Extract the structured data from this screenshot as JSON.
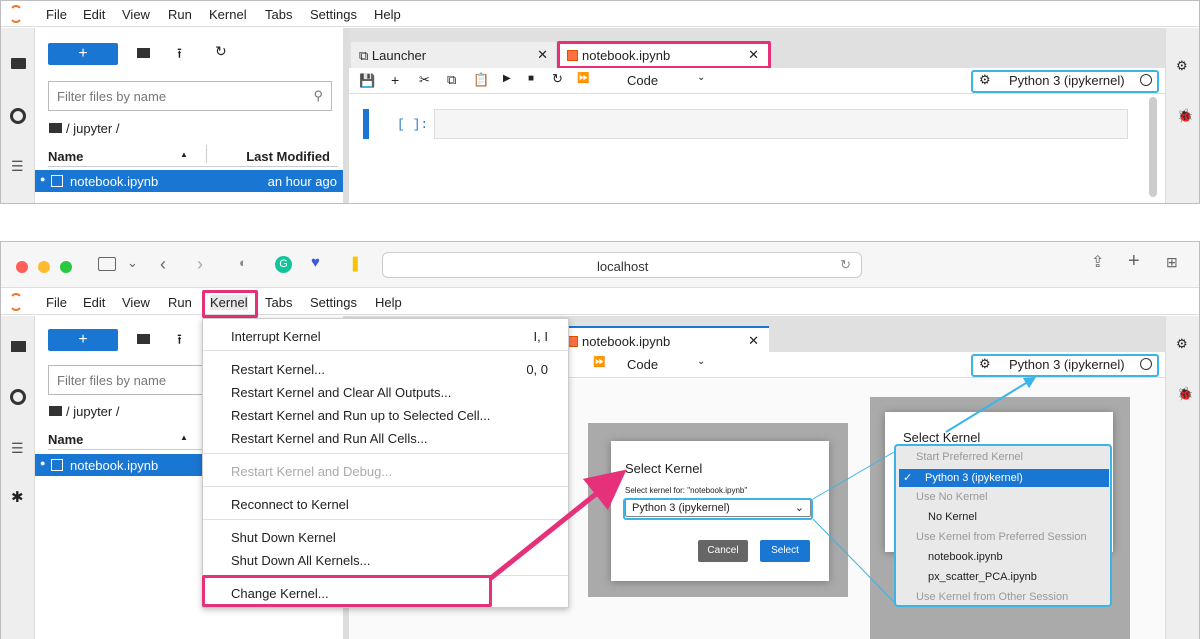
{
  "top": {
    "menu": [
      "File",
      "Edit",
      "View",
      "Run",
      "Kernel",
      "Tabs",
      "Settings",
      "Help"
    ],
    "filter_placeholder": "Filter files by name",
    "path": "/ jupyter /",
    "col_name": "Name",
    "col_modified": "Last Modified",
    "file_name": "notebook.ipynb",
    "file_modified": "an hour ago",
    "tab_launcher": "Launcher",
    "tab_notebook": "notebook.ipynb",
    "cell_type": "Code",
    "kernel_name": "Python 3 (ipykernel)",
    "prompt": "[ ]:"
  },
  "browser": {
    "url": "localhost"
  },
  "bottom": {
    "menu": [
      "File",
      "Edit",
      "View",
      "Run",
      "Kernel",
      "Tabs",
      "Settings",
      "Help"
    ],
    "filter_placeholder": "Filter files by name",
    "path": "/ jupyter /",
    "col_name": "Name",
    "file_name": "notebook.ipynb",
    "tab_notebook": "notebook.ipynb",
    "cell_type": "Code",
    "kernel_name": "Python 3 (ipykernel)"
  },
  "kernel_menu": {
    "items": [
      {
        "label": "Interrupt Kernel",
        "shortcut": "I, I"
      },
      {
        "label": "Restart Kernel...",
        "shortcut": "0, 0"
      },
      {
        "label": "Restart Kernel and Clear All Outputs...",
        "shortcut": ""
      },
      {
        "label": "Restart Kernel and Run up to Selected Cell...",
        "shortcut": ""
      },
      {
        "label": "Restart Kernel and Run All Cells...",
        "shortcut": ""
      },
      {
        "label": "Restart Kernel and Debug...",
        "shortcut": ""
      },
      {
        "label": "Reconnect to Kernel",
        "shortcut": ""
      },
      {
        "label": "Shut Down Kernel",
        "shortcut": ""
      },
      {
        "label": "Shut Down All Kernels...",
        "shortcut": ""
      },
      {
        "label": "Change Kernel...",
        "shortcut": ""
      }
    ]
  },
  "dialog": {
    "title": "Select Kernel",
    "label": "Select kernel for: \"notebook.ipynb\"",
    "selected": "Python 3 (ipykernel)",
    "cancel": "Cancel",
    "select": "Select"
  },
  "zoom_dialog": {
    "title": "Select Kernel",
    "options": [
      "Start Preferred Kernel",
      "Python 3 (ipykernel)",
      "Use No Kernel",
      "No Kernel",
      "Use Kernel from Preferred Session",
      "notebook.ipynb",
      "px_scatter_PCA.ipynb",
      "Use Kernel from Other Session"
    ]
  },
  "colors": {
    "accent": "#1976d2",
    "highlight_pink": "#e6307a",
    "highlight_blue": "#3bb4e8"
  }
}
